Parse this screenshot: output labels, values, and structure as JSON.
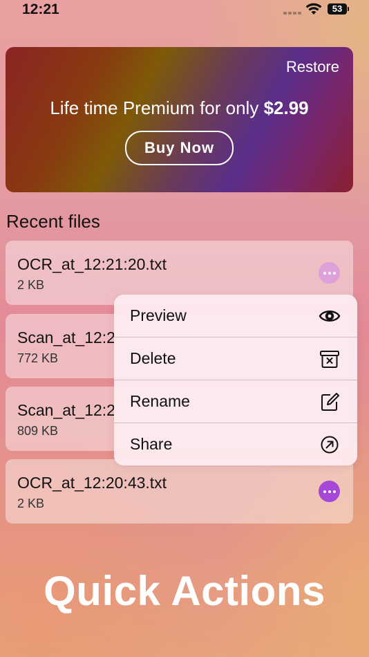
{
  "status_bar": {
    "time": "12:21",
    "battery": "53"
  },
  "promo": {
    "restore_label": "Restore",
    "text_prefix": "Life time Premium for only ",
    "price": "$2.99",
    "buy_label": "Buy Now"
  },
  "recent": {
    "title": "Recent files",
    "files": [
      {
        "name": "OCR_at_12:21:20.txt",
        "size": "2 KB"
      },
      {
        "name": "Scan_at_12:2",
        "size": "772 KB"
      },
      {
        "name": "Scan_at_12:2",
        "size": "809 KB"
      },
      {
        "name": "OCR_at_12:20:43.txt",
        "size": "2 KB"
      }
    ]
  },
  "context_menu": {
    "items": [
      {
        "label": "Preview",
        "icon": "eye-icon"
      },
      {
        "label": "Delete",
        "icon": "trash-icon"
      },
      {
        "label": "Rename",
        "icon": "edit-icon"
      },
      {
        "label": "Share",
        "icon": "share-icon"
      }
    ]
  },
  "headline": "Quick Actions",
  "colors": {
    "accent_purple": "#a548d8",
    "menu_background": "#fceaee",
    "text": "#111111"
  }
}
